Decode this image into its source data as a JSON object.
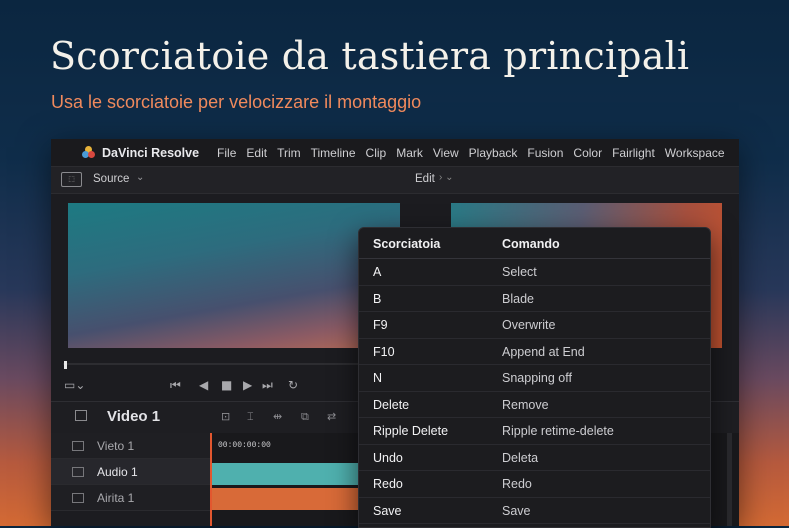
{
  "hero": {
    "title": "Scorciatoie da tastiera principali",
    "subtitle": "Usa le scorciatoie per velocizzare il montaggio"
  },
  "app": {
    "name": "DaVinci Resolve",
    "menu": [
      "File",
      "Edit",
      "Trim",
      "Timeline",
      "Clip",
      "Mark",
      "View",
      "Playback",
      "Fusion",
      "Color",
      "Fairlight",
      "Workspace"
    ]
  },
  "toolbar": {
    "source_label": "Source",
    "edit_label": "Edit"
  },
  "timeline": {
    "title": "Video 1",
    "timecode": "00:00:00:00",
    "tracks": [
      "Vieto 1",
      "Audio 1",
      "Airita 1"
    ]
  },
  "shortcuts": {
    "header_key": "Scorciatoia",
    "header_command": "Comando",
    "rows": [
      {
        "key": "A",
        "command": "Select"
      },
      {
        "key": "B",
        "command": "Blade"
      },
      {
        "key": "F9",
        "command": "Overwrite"
      },
      {
        "key": "F10",
        "command": "Append at End"
      },
      {
        "key": "N",
        "command": "Snapping off"
      },
      {
        "key": "Delete",
        "command": "Remove"
      },
      {
        "key": "Ripple Delete",
        "command": "Ripple retime-delete"
      },
      {
        "key": "Undo",
        "command": "Deleta"
      },
      {
        "key": "Redo",
        "command": "Redo"
      },
      {
        "key": "Save",
        "command": "Save"
      }
    ]
  },
  "colors": {
    "accent_orange": "#f08a5d",
    "clip_teal": "#4fb0ae",
    "clip_orange": "#d86a38",
    "playhead": "#e2572f"
  }
}
